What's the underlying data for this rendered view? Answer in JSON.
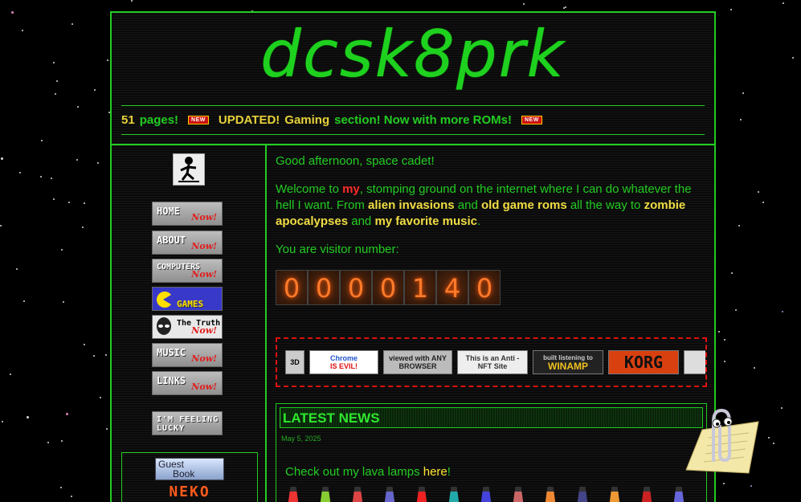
{
  "site": {
    "logo": "dcsk8prk",
    "ticker": {
      "count": "51",
      "pages_label": "pages!",
      "updated": "UPDATED!",
      "gaming": "Gaming",
      "rest": "section! Now with more ROMs!",
      "new_badge": "NEW"
    }
  },
  "nav": {
    "home": "HOME",
    "about": "ABOUT",
    "computers": "COMPUTERS",
    "games": "GAMES",
    "truth": "The Truth",
    "music": "MUSIC",
    "links": "LINKS",
    "now": "Now!",
    "lucky": "I'M FEELING LUCKY",
    "guest": "Guest",
    "book": "Book",
    "neko": "NEKO"
  },
  "main": {
    "greeting": "Good afternoon, space cadet!",
    "welcome_pre": "Welcome to ",
    "welcome_my": "my",
    "welcome_mid": ", stomping ground on the internet where I can do whatever the hell I want. From ",
    "aliens": "alien invasions",
    "and1": " and ",
    "roms": "old game roms",
    "mid2": " all the way to ",
    "zombies": "zombie apocalypses",
    "and2": " and ",
    "music": "my favorite music",
    "end": ".",
    "visitor_label": "You are visitor number:",
    "counter_digits": [
      "0",
      "0",
      "0",
      "0",
      "1",
      "4",
      "0"
    ]
  },
  "badges": {
    "b3d": "3D",
    "chrome_top": "Chrome",
    "chrome": "IS EVIL!",
    "anybrowser": "viewed with ANY BROWSER",
    "antinft": "This is an Anti - NFT Site",
    "winamp_top": "built listening to",
    "winamp": "WINAMP",
    "korg": "KORG"
  },
  "news": {
    "heading": "LATEST NEWS",
    "date": "May 5, 2025",
    "text_pre": "Check out my lava lamps ",
    "link": "here",
    "text_post": "!"
  }
}
